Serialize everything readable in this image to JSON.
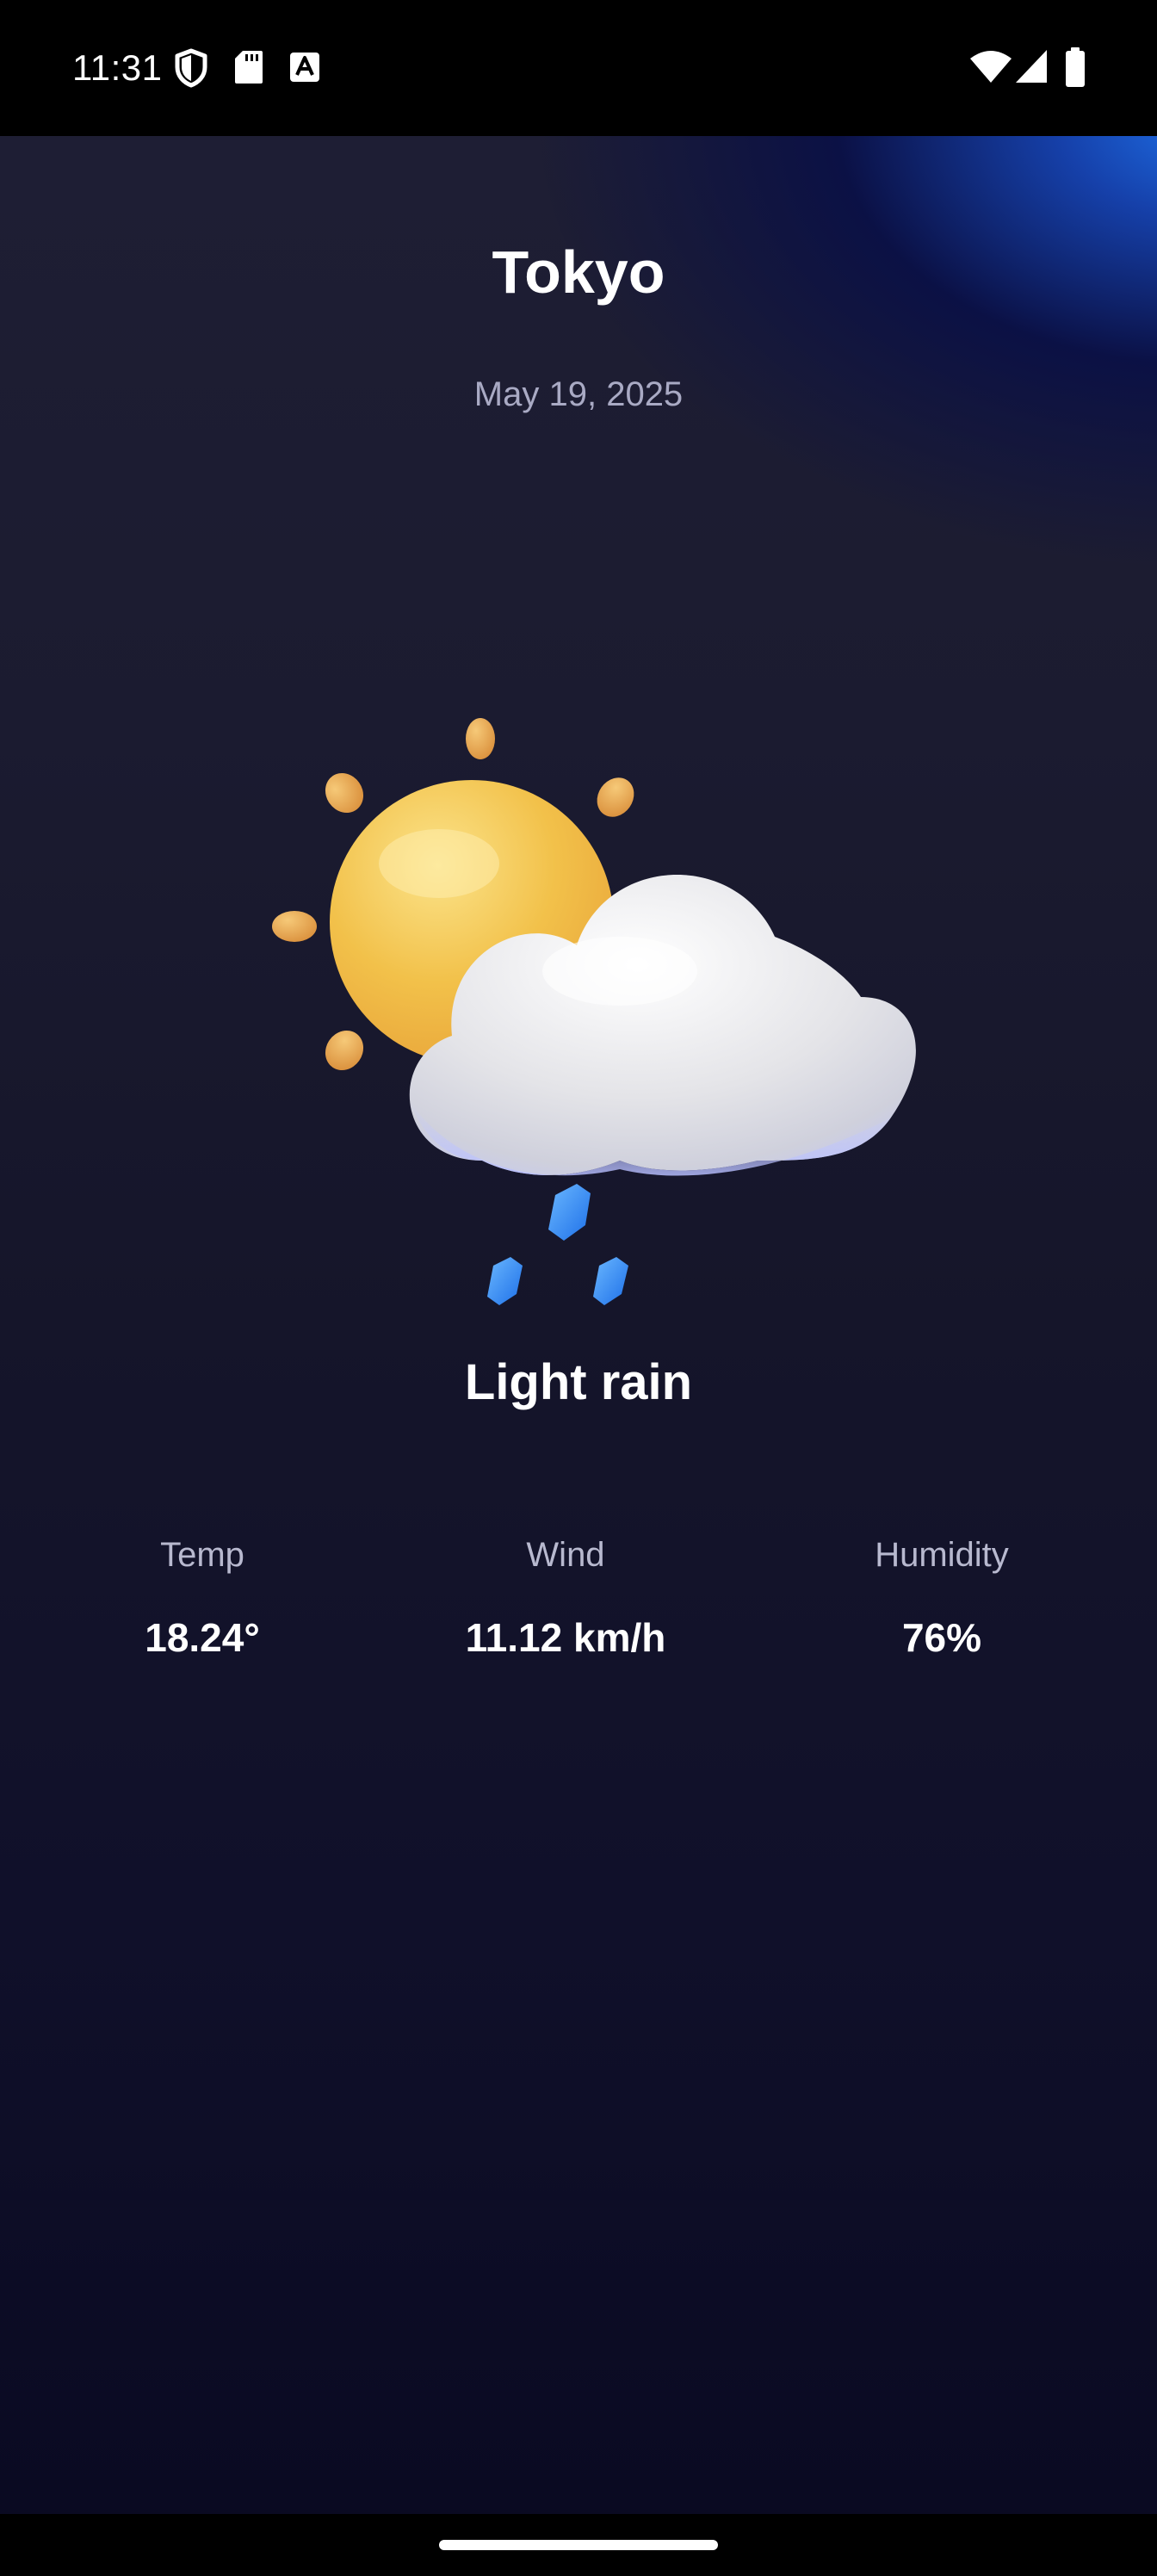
{
  "status_bar": {
    "time": "11:31",
    "left_icons": [
      "shield-icon",
      "sd-card-icon",
      "text-a-icon"
    ],
    "right_icons": [
      "wifi-icon",
      "cellular-signal-icon",
      "battery-icon"
    ]
  },
  "weather": {
    "city": "Tokyo",
    "date": "May 19, 2025",
    "icon": "sun-cloud-rain-icon",
    "condition": "Light rain",
    "stats": [
      {
        "label": "Temp",
        "value": "18.24°"
      },
      {
        "label": "Wind",
        "value": "11.12 km/h"
      },
      {
        "label": "Humidity",
        "value": "76%"
      }
    ]
  },
  "colors": {
    "background_top": "#1e1e34",
    "background_bottom": "#0a0a22",
    "accent_glow": "#1e6ee6",
    "sun": "#f2c14a",
    "rain": "#2f86f5"
  }
}
